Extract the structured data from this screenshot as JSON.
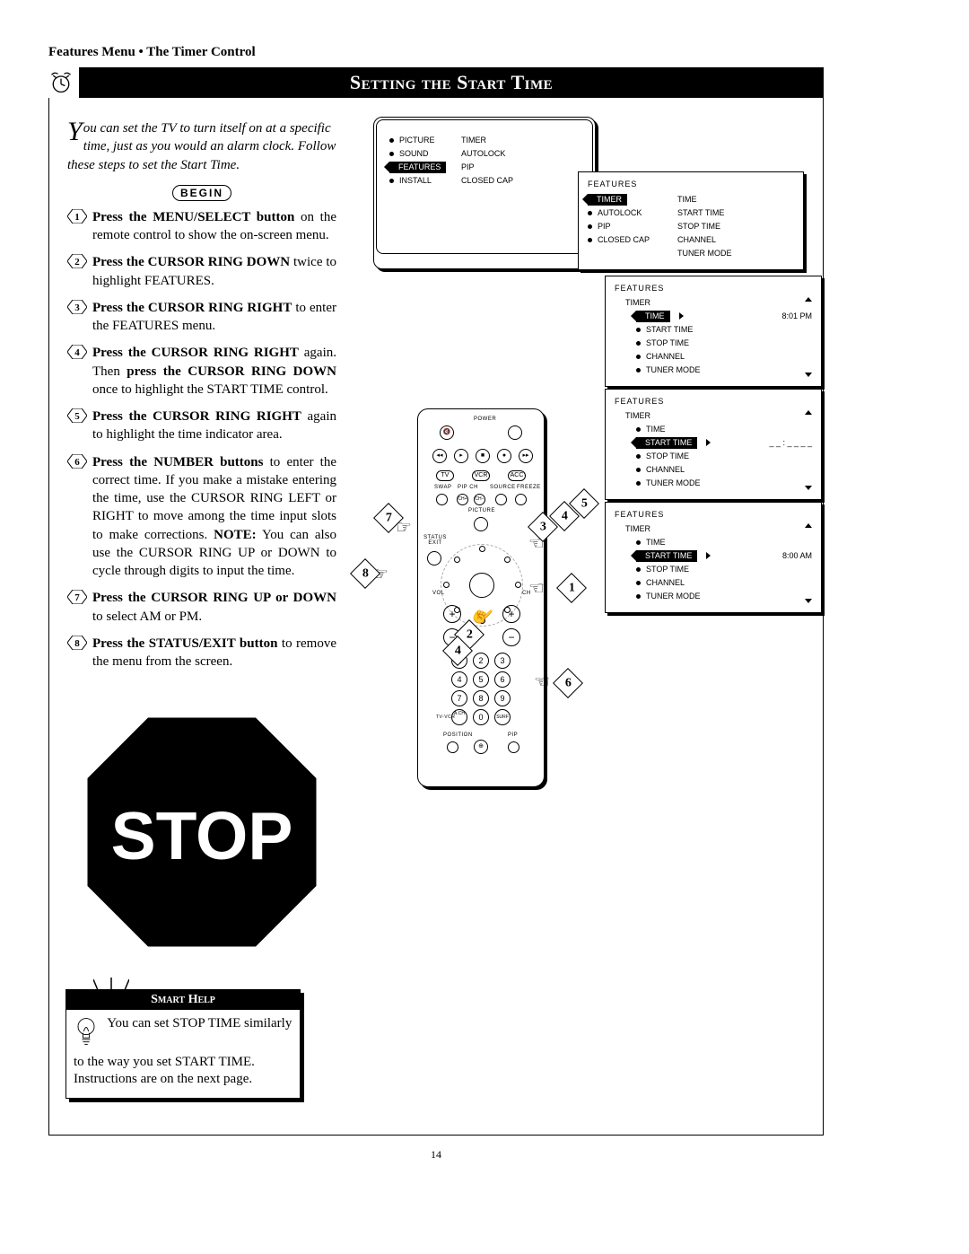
{
  "breadcrumb": "Features Menu • The Timer Control",
  "title": "Setting the Start Time",
  "intro": {
    "dropcap": "Y",
    "text": "ou can set the TV to turn itself on at a specific time, just as you would an alarm clock. Follow these steps to set the Start Time."
  },
  "begin_label": "BEGIN",
  "steps": [
    {
      "n": "1",
      "bold": "Press the MENU/SELECT button",
      "rest": " on the remote control to show the on-screen menu."
    },
    {
      "n": "2",
      "bold": "Press the CURSOR RING DOWN",
      "rest": " twice to highlight FEATURES."
    },
    {
      "n": "3",
      "bold": "Press the CURSOR RING RIGHT",
      "rest": " to enter the FEATURES menu."
    },
    {
      "n": "4",
      "bold": "Press the CURSOR RING RIGHT",
      "rest": " again. Then ",
      "bold2": "press the CURSOR RING DOWN",
      "rest2": " once to highlight the START TIME control."
    },
    {
      "n": "5",
      "bold": "Press the CURSOR RING RIGHT",
      "rest": " again to highlight the time indicator area."
    },
    {
      "n": "6",
      "bold": "Press the NUMBER buttons",
      "rest": " to enter the correct time. If you make a mistake entering the time, use the CURSOR RING LEFT or RIGHT to move among the time input slots to make corrections. ",
      "bold2": "NOTE:",
      "rest2": " You can also use the CURSOR RING UP or DOWN to cycle through digits to input the time."
    },
    {
      "n": "7",
      "bold": "Press the CURSOR RING UP or DOWN",
      "rest": " to select AM or PM."
    },
    {
      "n": "8",
      "bold": "Press the STATUS/EXIT button",
      "rest": " to remove the menu from the screen."
    }
  ],
  "stop_label": "STOP",
  "smart_help": {
    "title": "Smart Help",
    "body": "You can set STOP TIME similarly to the way you set START TIME. Instructions are on the next page."
  },
  "page_number": "14",
  "tv_menu": {
    "colA": [
      "PICTURE",
      "SOUND",
      "FEATURES",
      "INSTALL"
    ],
    "colB": [
      "TIMER",
      "AUTOLOCK",
      "PIP",
      "CLOSED CAP"
    ],
    "selected_index": 2
  },
  "panel_features": {
    "title": "FEATURES",
    "items": [
      "TIMER",
      "AUTOLOCK",
      "PIP",
      "CLOSED CAP"
    ],
    "right_items": [
      "TIME",
      "START TIME",
      "STOP TIME",
      "CHANNEL",
      "TUNER MODE"
    ],
    "selected_index": 0
  },
  "panel_timer1": {
    "title": "FEATURES",
    "subtitle": "TIMER",
    "items": [
      "TIME",
      "START TIME",
      "STOP TIME",
      "CHANNEL",
      "TUNER MODE"
    ],
    "selected_index": 0,
    "value": "8:01 PM"
  },
  "panel_timer2": {
    "title": "FEATURES",
    "subtitle": "TIMER",
    "items": [
      "TIME",
      "START TIME",
      "STOP TIME",
      "CHANNEL",
      "TUNER MODE"
    ],
    "selected_index": 1,
    "value": "_ _ : _ _  _ _"
  },
  "panel_timer3": {
    "title": "FEATURES",
    "subtitle": "TIMER",
    "items": [
      "TIME",
      "START TIME",
      "STOP TIME",
      "CHANNEL",
      "TUNER MODE"
    ],
    "selected_index": 1,
    "value": "8:00 AM"
  },
  "remote": {
    "labels": {
      "power": "POWER",
      "tv": "TV",
      "vcr": "VCR",
      "acc": "ACC",
      "swap": "SWAP",
      "pip_ch": "PIP CH",
      "source": "SOURCE",
      "freeze": "FREEZE",
      "picture": "PICTURE",
      "status_exit": "STATUS\nEXIT",
      "vol": "VOL",
      "ch": "CH",
      "tv_vcr": "TV-VCR",
      "a_ch": "A.CH",
      "surf": "SURF",
      "position": "POSITION",
      "pip": "PIP",
      "ch_up": "CH+",
      "ch_down": "CH−"
    },
    "numpad": [
      "1",
      "2",
      "3",
      "4",
      "5",
      "6",
      "7",
      "8",
      "9",
      "0"
    ]
  },
  "callouts": [
    "1",
    "2",
    "3",
    "4",
    "5",
    "6",
    "7",
    "8"
  ]
}
